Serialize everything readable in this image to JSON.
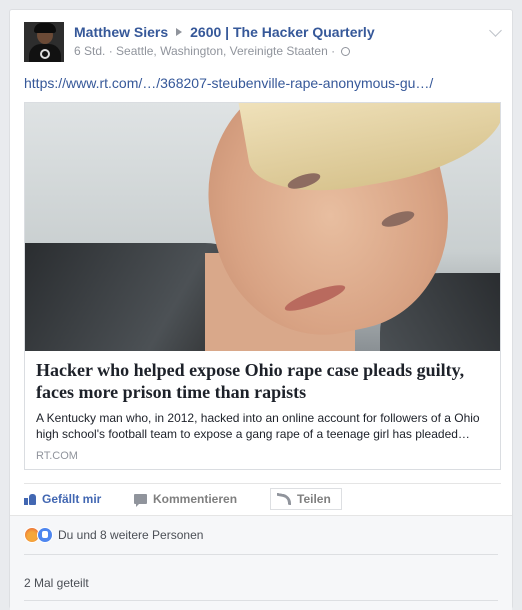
{
  "post": {
    "author": "Matthew Siers",
    "group": "2600 | The Hacker Quarterly",
    "time": "6 Std.",
    "location": "Seattle, Washington, Vereinigte Staaten",
    "separator": "·",
    "link_text": "https://www.rt.com/…/368207-steubenville-rape-anonymous-gu…/"
  },
  "share": {
    "title": "Hacker who helped expose Ohio rape case pleads guilty, faces more prison time than rapists",
    "description": "A Kentucky man who, in 2012, hacked into an online account for followers of a Ohio high school's football team to expose a gang rape of a teenage girl has pleaded…",
    "domain": "RT.COM"
  },
  "actions": {
    "like": "Gefällt mir",
    "comment": "Kommentieren",
    "share": "Teilen"
  },
  "footer": {
    "reactions_text": "Du und 8 weitere Personen",
    "shares_text": "2 Mal geteilt"
  },
  "colors": {
    "link": "#365899",
    "like_active": "#4267b2",
    "background": "#e9ebee"
  }
}
